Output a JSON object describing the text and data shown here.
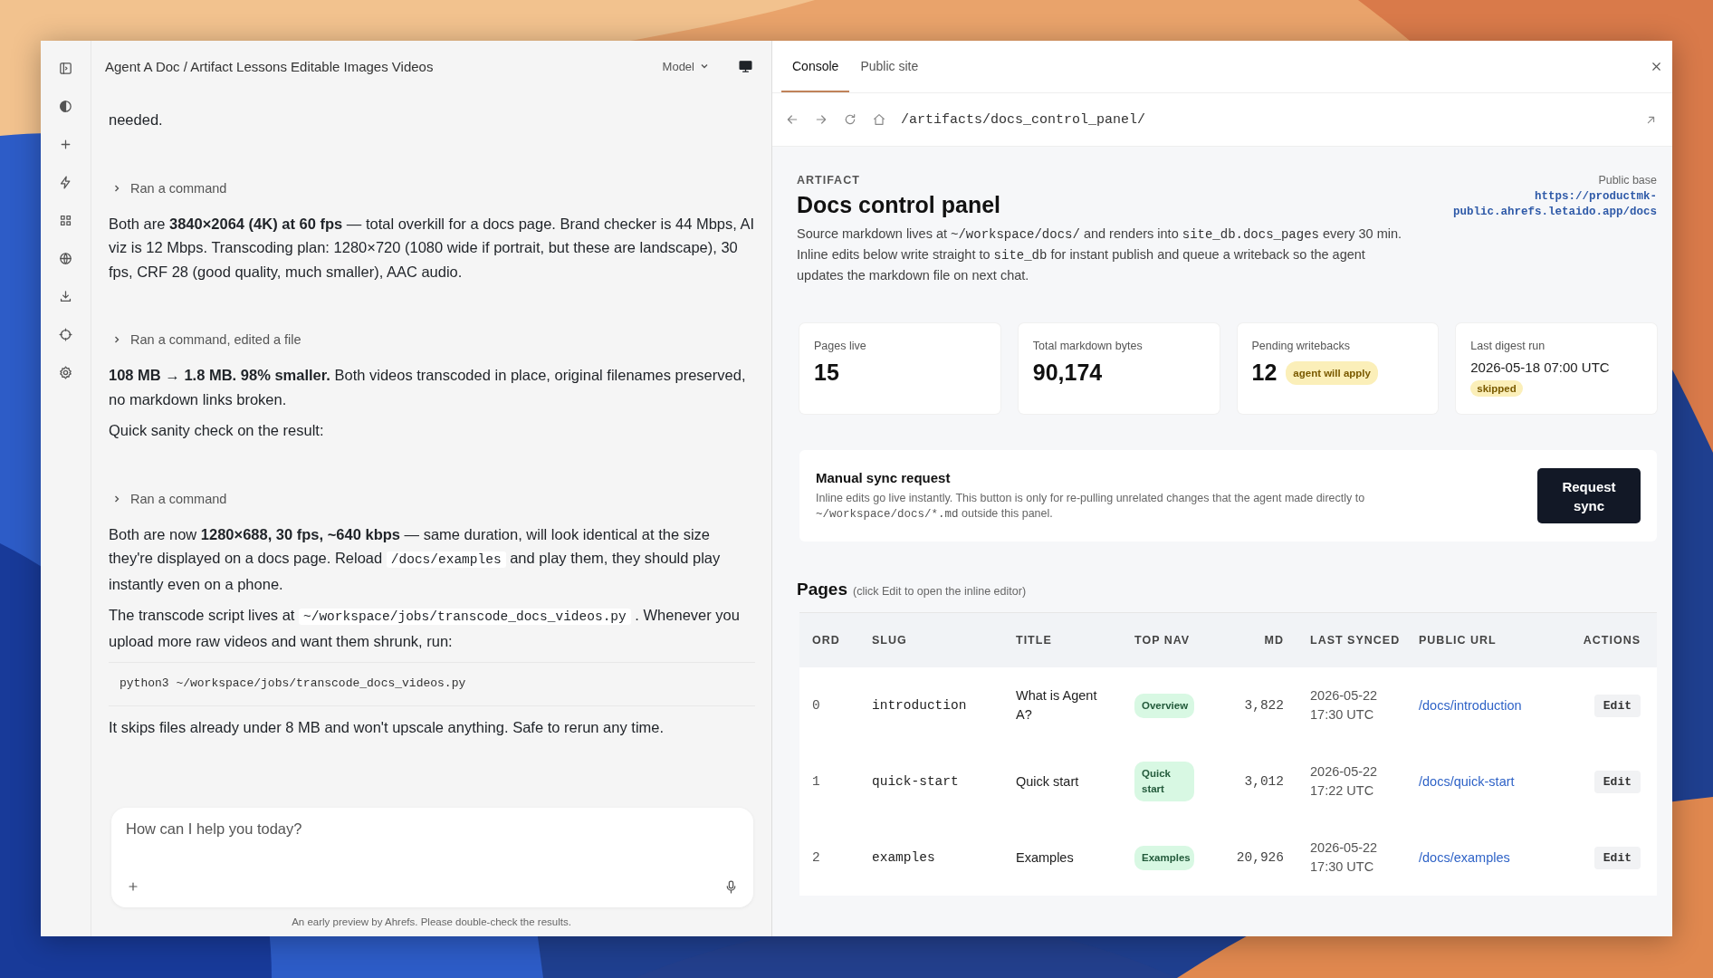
{
  "chat": {
    "title": "Agent A Doc / Artifact Lessons Editable Images Videos",
    "model_button": "Model",
    "messages": [
      {
        "kind": "paragraph",
        "parts": [
          {
            "kind": "text",
            "text": "needed."
          }
        ]
      },
      {
        "kind": "command",
        "text": "Ran a command"
      },
      {
        "kind": "paragraph",
        "parts": [
          {
            "kind": "text",
            "text": "Both are **3840×2064 (4K) at 60 fps** — total overkill for a docs page. Brand checker is 44 Mbps, AI viz is 12 Mbps. Transcoding plan: 1280×720 (1080 wide if portrait, but these are landscape), 30 fps, CRF 28 (good quality, much smaller), AAC audio."
          }
        ]
      },
      {
        "kind": "command",
        "text": "Ran a command, edited a file"
      },
      {
        "kind": "paragraph",
        "parts": [
          {
            "kind": "text",
            "text": "**108 MB → 1.8 MB. 98% smaller.** Both videos transcoded in place, original filenames preserved, no markdown links broken."
          }
        ]
      },
      {
        "kind": "paragraph",
        "parts": [
          {
            "kind": "text",
            "text": "Quick sanity check on the result:"
          }
        ]
      },
      {
        "kind": "command",
        "text": "Ran a command"
      },
      {
        "kind": "paragraph",
        "parts": [
          {
            "kind": "text",
            "text": "Both are now **1280×688, 30 fps, ~640 kbps** — same duration, will look identical at the size they're displayed on a docs page. Reload "
          },
          {
            "kind": "code",
            "text": "/docs/examples"
          },
          {
            "kind": "text",
            "text": " and play them, they should play instantly even on a phone."
          }
        ]
      },
      {
        "kind": "paragraph",
        "parts": [
          {
            "kind": "text",
            "text": "The transcode script lives at "
          },
          {
            "kind": "code",
            "text": "~/workspace/jobs/transcode_docs_videos.py"
          },
          {
            "kind": "text",
            "text": " . Whenever you upload more raw videos and want them shrunk, run:"
          }
        ]
      },
      {
        "kind": "code",
        "text": "python3 ~/workspace/jobs/transcode_docs_videos.py"
      },
      {
        "kind": "paragraph",
        "parts": [
          {
            "kind": "text",
            "text": "It skips files already under 8 MB and won't upscale anything. Safe to rerun any time."
          }
        ]
      }
    ],
    "composer": {
      "placeholder": "How can I help you today?"
    },
    "footer": "An early preview by Ahrefs. Please double-check the results."
  },
  "panel": {
    "tabs": [
      {
        "label": "Console",
        "selected": true
      },
      {
        "label": "Public site",
        "selected": false
      }
    ],
    "url": "/artifacts/docs_control_panel/",
    "eyebrow": "ARTIFACT",
    "title": "Docs control panel",
    "description": [
      {
        "kind": "text",
        "text": "Source markdown lives at "
      },
      {
        "kind": "code",
        "text": "~/workspace/docs/"
      },
      {
        "kind": "text",
        "text": " and renders into "
      },
      {
        "kind": "code",
        "text": "site_db.docs_pages"
      },
      {
        "kind": "text",
        "text": " every 30 min. Inline edits below write straight to "
      },
      {
        "kind": "code",
        "text": "site_db"
      },
      {
        "kind": "text",
        "text": " for instant publish and queue a writeback so the agent updates the markdown file on next chat."
      }
    ],
    "public_base": {
      "label": "Public base",
      "url": "https://productmk-public.ahrefs.letaido.app/docs"
    },
    "stats": [
      {
        "label": "Pages live",
        "kind": "number",
        "value": "15"
      },
      {
        "label": "Total markdown bytes",
        "kind": "number",
        "value": "90,174"
      },
      {
        "label": "Pending writebacks",
        "kind": "number",
        "value": "12",
        "badge": "agent will apply"
      },
      {
        "label": "Last digest run",
        "kind": "date",
        "value": "2026-05-18 07:00 UTC",
        "badge": "skipped"
      }
    ],
    "sync": {
      "title": "Manual sync request",
      "description": [
        {
          "kind": "text",
          "text": "Inline edits go live instantly. This button is only for re-pulling unrelated changes that the agent made directly to "
        },
        {
          "kind": "code",
          "text": "~/workspace/docs/*.md"
        },
        {
          "kind": "text",
          "text": " outside this panel."
        }
      ],
      "button": "Request sync"
    },
    "pages": {
      "title": "Pages",
      "hint": "(click Edit to open the inline editor)",
      "columns": [
        "ORD",
        "SLUG",
        "TITLE",
        "TOP NAV",
        "MD",
        "LAST SYNCED",
        "PUBLIC URL",
        "ACTIONS"
      ],
      "rows": [
        {
          "ord": "0",
          "slug": "introduction",
          "title": "What is Agent A?",
          "top_nav": "Overview",
          "md": "3,822",
          "last_synced": "2026-05-22 17:30 UTC",
          "public_url": "/docs/introduction",
          "action": "Edit"
        },
        {
          "ord": "1",
          "slug": "quick-start",
          "title": "Quick start",
          "top_nav": "Quick start",
          "md": "3,012",
          "last_synced": "2026-05-22 17:22 UTC",
          "public_url": "/docs/quick-start",
          "action": "Edit"
        },
        {
          "ord": "2",
          "slug": "examples",
          "title": "Examples",
          "top_nav": "Examples",
          "md": "20,926",
          "last_synced": "2026-05-22 17:30 UTC",
          "public_url": "/docs/examples",
          "action": "Edit"
        }
      ]
    }
  }
}
